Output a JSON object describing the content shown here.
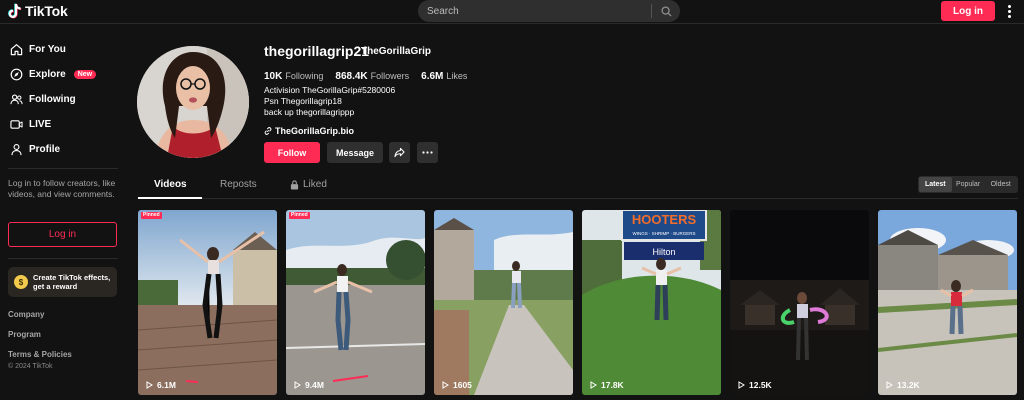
{
  "app": {
    "name": "TikTok"
  },
  "search": {
    "placeholder": "Search"
  },
  "header": {
    "login_label": "Log in"
  },
  "sidebar": {
    "items": [
      {
        "label": "For You",
        "icon": "home-icon"
      },
      {
        "label": "Explore",
        "icon": "compass-icon",
        "badge": "New"
      },
      {
        "label": "Following",
        "icon": "users-icon"
      },
      {
        "label": "LIVE",
        "icon": "live-icon"
      },
      {
        "label": "Profile",
        "icon": "person-icon"
      }
    ],
    "login_prompt": "Log in to follow creators, like videos, and view comments.",
    "login_label": "Log in",
    "effects_label": "Create TikTok effects, get a reward",
    "links": [
      "Company",
      "Program",
      "Terms & Policies"
    ],
    "copyright": "© 2024 TikTok"
  },
  "profile": {
    "username": "thegorillagrip21",
    "nickname": "TheGorillaGrip",
    "stats": [
      {
        "value": "10K",
        "label": "Following"
      },
      {
        "value": "868.4K",
        "label": "Followers"
      },
      {
        "value": "6.6M",
        "label": "Likes"
      }
    ],
    "bio": [
      "Activision TheGorillaGrip#5280006",
      "Psn Thegorillagrip18",
      "back up thegorillagrippp"
    ],
    "link": "TheGorillaGrip.bio",
    "follow_label": "Follow",
    "message_label": "Message"
  },
  "tabs": [
    "Videos",
    "Reposts",
    "Liked"
  ],
  "sort_options": [
    "Latest",
    "Popular",
    "Oldest"
  ],
  "videos": [
    {
      "views": "6.1M",
      "pinned": "Pinned"
    },
    {
      "views": "9.4M",
      "pinned": "Pinned"
    },
    {
      "views": "1605"
    },
    {
      "views": "17.8K"
    },
    {
      "views": "12.5K"
    },
    {
      "views": "13.2K"
    }
  ],
  "thumb_text": {
    "hooters": "HOOTERS",
    "hooters_sub": "WINGS · SHRIMP · BURGERS",
    "hilton": "Hilton"
  },
  "colors": {
    "accent": "#fe2c55",
    "background": "#121212"
  }
}
